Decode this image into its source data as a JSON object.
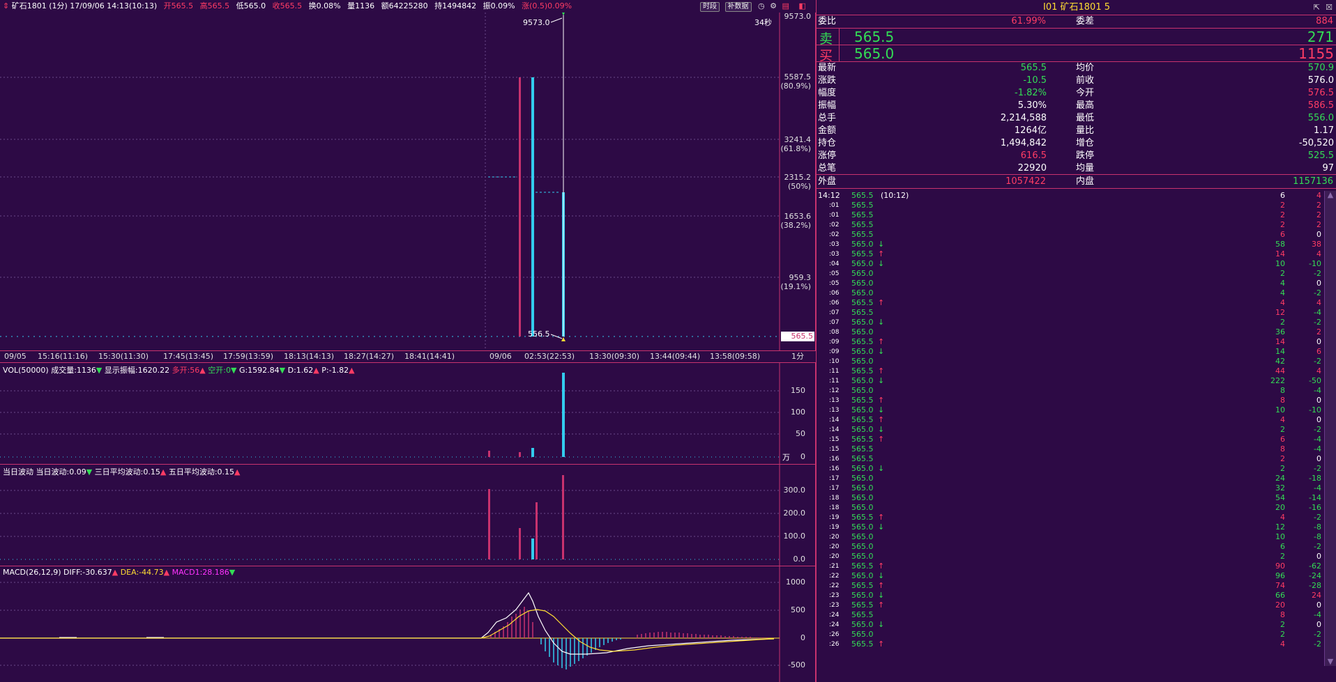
{
  "header": {
    "symbol": "矿石1801 (1分) 17/09/06 14:13(10:13)",
    "open": "开565.5",
    "high": "高565.5",
    "low": "低565.0",
    "close": "收565.5",
    "turnover": "换0.08%",
    "volume": "量1136",
    "amount": "额64225280",
    "position": "持1494842",
    "amplitude": "振0.09%",
    "change": "涨(0.5)0.09%",
    "btn_timeshare": "时段",
    "btn_supplement": "补数据"
  },
  "price_chart": {
    "countdown": "34秒",
    "peak_label": "9573.0",
    "low_label": "556.5",
    "current_price_tag": "565.5",
    "axis": [
      {
        "price": "9573.0",
        "pct": ""
      },
      {
        "price": "5587.5",
        "pct": "(80.9%)"
      },
      {
        "price": "3241.4",
        "pct": "(61.8%)"
      },
      {
        "price": "2315.2",
        "pct": "(50%)"
      },
      {
        "price": "1653.6",
        "pct": "(38.2%)"
      },
      {
        "price": "959.3",
        "pct": "(19.1%)"
      }
    ],
    "time_labels": [
      "09/05",
      "15:16(11:16)",
      "15:30(11:30)",
      "17:45(13:45)",
      "17:59(13:59)",
      "18:13(14:13)",
      "18:27(14:27)",
      "18:41(14:41)",
      "09/06",
      "02:53(22:53)",
      "13:30(09:30)",
      "13:44(09:44)",
      "13:58(09:58)"
    ],
    "period": "1分"
  },
  "vol_panel": {
    "title": "VOL(50000)",
    "volume": "成交量:1136",
    "display_amp": "显示振幅:1620.22",
    "long_open": "多开:56",
    "short_open": "空开:0",
    "g": "G:1592.84",
    "d": "D:1.62",
    "p": "P:-1.82",
    "axis": [
      "150",
      "100",
      "50",
      "0"
    ],
    "unit": "万"
  },
  "wave_panel": {
    "title": "当日波动",
    "today": "当日波动:0.09",
    "three_day": "三日平均波动:0.15",
    "five_day": "五日平均波动:0.15",
    "axis": [
      "300.0",
      "200.0",
      "100.0",
      "0.0"
    ]
  },
  "macd_panel": {
    "title": "MACD(26,12,9)",
    "diff": "DIFF:-30.637",
    "dea": "DEA:-44.73",
    "macd1": "MACD1:28.186",
    "axis": [
      "1000",
      "500",
      "0",
      "-500"
    ]
  },
  "quote": {
    "title": "I01 矿石1801 5",
    "ratio_label": "委比",
    "ratio_value": "61.99%",
    "diff_label": "委差",
    "diff_value": "884",
    "sell_label": "卖",
    "sell_price": "565.5",
    "sell_vol": "271",
    "buy_label": "买",
    "buy_price": "565.0",
    "buy_vol": "1155",
    "stats": [
      {
        "l": "最新",
        "v": "565.5",
        "vc": "green",
        "r": "均价",
        "rv": "570.9",
        "rc": "green"
      },
      {
        "l": "涨跌",
        "v": "-10.5",
        "vc": "green",
        "r": "前收",
        "rv": "576.0",
        "rc": "white"
      },
      {
        "l": "幅度",
        "v": "-1.82%",
        "vc": "green",
        "r": "今开",
        "rv": "576.5",
        "rc": "red"
      },
      {
        "l": "振幅",
        "v": "5.30%",
        "vc": "white",
        "r": "最高",
        "rv": "586.5",
        "rc": "red"
      },
      {
        "l": "总手",
        "v": "2,214,588",
        "vc": "white",
        "r": "最低",
        "rv": "556.0",
        "rc": "green"
      },
      {
        "l": "金额",
        "v": "1264亿",
        "vc": "white",
        "r": "量比",
        "rv": "1.17",
        "rc": "white"
      },
      {
        "l": "持仓",
        "v": "1,494,842",
        "vc": "white",
        "r": "增仓",
        "rv": "-50,520",
        "rc": "white"
      },
      {
        "l": "涨停",
        "v": "616.5",
        "vc": "red",
        "r": "跌停",
        "rv": "525.5",
        "rc": "green"
      },
      {
        "l": "总笔",
        "v": "22920",
        "vc": "white",
        "r": "均量",
        "rv": "97",
        "rc": "white"
      }
    ],
    "outer_label": "外盘",
    "outer_value": "1057422",
    "inner_label": "内盘",
    "inner_value": "1157136"
  },
  "ticks_header": {
    "time": "14:12",
    "price": "565.5",
    "note": "(10:12)",
    "vol": "6",
    "chg": "4"
  },
  "ticks": [
    {
      "t": ":01",
      "p": "565.5",
      "a": "",
      "v": "2",
      "c": "2",
      "vc": "red",
      "cc": "red"
    },
    {
      "t": ":01",
      "p": "565.5",
      "a": "",
      "v": "2",
      "c": "2",
      "vc": "red",
      "cc": "red"
    },
    {
      "t": ":02",
      "p": "565.5",
      "a": "",
      "v": "2",
      "c": "2",
      "vc": "red",
      "cc": "red"
    },
    {
      "t": ":02",
      "p": "565.5",
      "a": "",
      "v": "6",
      "c": "0",
      "vc": "red",
      "cc": "white"
    },
    {
      "t": ":03",
      "p": "565.0",
      "a": "↓",
      "v": "58",
      "c": "38",
      "vc": "green",
      "cc": "red"
    },
    {
      "t": ":03",
      "p": "565.5",
      "a": "↑",
      "v": "14",
      "c": "4",
      "vc": "red",
      "cc": "red"
    },
    {
      "t": ":04",
      "p": "565.0",
      "a": "↓",
      "v": "10",
      "c": "-10",
      "vc": "green",
      "cc": "green"
    },
    {
      "t": ":05",
      "p": "565.0",
      "a": "",
      "v": "2",
      "c": "-2",
      "vc": "green",
      "cc": "green"
    },
    {
      "t": ":05",
      "p": "565.0",
      "a": "",
      "v": "4",
      "c": "0",
      "vc": "green",
      "cc": "white"
    },
    {
      "t": ":06",
      "p": "565.0",
      "a": "",
      "v": "4",
      "c": "-2",
      "vc": "green",
      "cc": "green"
    },
    {
      "t": ":06",
      "p": "565.5",
      "a": "↑",
      "v": "4",
      "c": "4",
      "vc": "red",
      "cc": "red"
    },
    {
      "t": ":07",
      "p": "565.5",
      "a": "",
      "v": "12",
      "c": "-4",
      "vc": "red",
      "cc": "green"
    },
    {
      "t": ":07",
      "p": "565.0",
      "a": "↓",
      "v": "2",
      "c": "-2",
      "vc": "green",
      "cc": "green"
    },
    {
      "t": ":08",
      "p": "565.0",
      "a": "",
      "v": "36",
      "c": "2",
      "vc": "green",
      "cc": "red"
    },
    {
      "t": ":09",
      "p": "565.5",
      "a": "↑",
      "v": "14",
      "c": "0",
      "vc": "red",
      "cc": "white"
    },
    {
      "t": ":09",
      "p": "565.0",
      "a": "↓",
      "v": "14",
      "c": "6",
      "vc": "green",
      "cc": "red"
    },
    {
      "t": ":10",
      "p": "565.0",
      "a": "",
      "v": "42",
      "c": "-2",
      "vc": "green",
      "cc": "green"
    },
    {
      "t": ":11",
      "p": "565.5",
      "a": "↑",
      "v": "44",
      "c": "4",
      "vc": "red",
      "cc": "red"
    },
    {
      "t": ":11",
      "p": "565.0",
      "a": "↓",
      "v": "222",
      "c": "-50",
      "vc": "green",
      "cc": "green"
    },
    {
      "t": ":12",
      "p": "565.0",
      "a": "",
      "v": "8",
      "c": "-4",
      "vc": "green",
      "cc": "green"
    },
    {
      "t": ":13",
      "p": "565.5",
      "a": "↑",
      "v": "8",
      "c": "0",
      "vc": "red",
      "cc": "white"
    },
    {
      "t": ":13",
      "p": "565.0",
      "a": "↓",
      "v": "10",
      "c": "-10",
      "vc": "green",
      "cc": "green"
    },
    {
      "t": ":14",
      "p": "565.5",
      "a": "↑",
      "v": "4",
      "c": "0",
      "vc": "red",
      "cc": "white"
    },
    {
      "t": ":14",
      "p": "565.0",
      "a": "↓",
      "v": "2",
      "c": "-2",
      "vc": "green",
      "cc": "green"
    },
    {
      "t": ":15",
      "p": "565.5",
      "a": "↑",
      "v": "6",
      "c": "-4",
      "vc": "red",
      "cc": "green"
    },
    {
      "t": ":15",
      "p": "565.5",
      "a": "",
      "v": "8",
      "c": "-4",
      "vc": "red",
      "cc": "green"
    },
    {
      "t": ":16",
      "p": "565.5",
      "a": "",
      "v": "2",
      "c": "0",
      "vc": "red",
      "cc": "white"
    },
    {
      "t": ":16",
      "p": "565.0",
      "a": "↓",
      "v": "2",
      "c": "-2",
      "vc": "green",
      "cc": "green"
    },
    {
      "t": ":17",
      "p": "565.0",
      "a": "",
      "v": "24",
      "c": "-18",
      "vc": "green",
      "cc": "green"
    },
    {
      "t": ":17",
      "p": "565.0",
      "a": "",
      "v": "32",
      "c": "-4",
      "vc": "green",
      "cc": "green"
    },
    {
      "t": ":18",
      "p": "565.0",
      "a": "",
      "v": "54",
      "c": "-14",
      "vc": "green",
      "cc": "green"
    },
    {
      "t": ":18",
      "p": "565.0",
      "a": "",
      "v": "20",
      "c": "-16",
      "vc": "green",
      "cc": "green"
    },
    {
      "t": ":19",
      "p": "565.5",
      "a": "↑",
      "v": "4",
      "c": "-2",
      "vc": "red",
      "cc": "green"
    },
    {
      "t": ":19",
      "p": "565.0",
      "a": "↓",
      "v": "12",
      "c": "-8",
      "vc": "green",
      "cc": "green"
    },
    {
      "t": ":20",
      "p": "565.0",
      "a": "",
      "v": "10",
      "c": "-8",
      "vc": "green",
      "cc": "green"
    },
    {
      "t": ":20",
      "p": "565.0",
      "a": "",
      "v": "6",
      "c": "-2",
      "vc": "green",
      "cc": "green"
    },
    {
      "t": ":20",
      "p": "565.0",
      "a": "",
      "v": "2",
      "c": "0",
      "vc": "green",
      "cc": "white"
    },
    {
      "t": ":21",
      "p": "565.5",
      "a": "↑",
      "v": "90",
      "c": "-62",
      "vc": "red",
      "cc": "green"
    },
    {
      "t": ":22",
      "p": "565.0",
      "a": "↓",
      "v": "96",
      "c": "-24",
      "vc": "green",
      "cc": "green"
    },
    {
      "t": ":22",
      "p": "565.5",
      "a": "↑",
      "v": "74",
      "c": "-28",
      "vc": "red",
      "cc": "green"
    },
    {
      "t": ":23",
      "p": "565.0",
      "a": "↓",
      "v": "66",
      "c": "24",
      "vc": "green",
      "cc": "red"
    },
    {
      "t": ":23",
      "p": "565.5",
      "a": "↑",
      "v": "20",
      "c": "0",
      "vc": "red",
      "cc": "white"
    },
    {
      "t": ":24",
      "p": "565.5",
      "a": "",
      "v": "8",
      "c": "-4",
      "vc": "red",
      "cc": "green"
    },
    {
      "t": ":24",
      "p": "565.0",
      "a": "↓",
      "v": "2",
      "c": "0",
      "vc": "green",
      "cc": "white"
    },
    {
      "t": ":26",
      "p": "565.0",
      "a": "",
      "v": "2",
      "c": "-2",
      "vc": "green",
      "cc": "green"
    },
    {
      "t": ":26",
      "p": "565.5",
      "a": "↑",
      "v": "4",
      "c": "-2",
      "vc": "red",
      "cc": "green"
    }
  ],
  "colors": {
    "bg": "#2d0a45",
    "up": "#ff3c64",
    "down": "#33dd55",
    "cyan": "#33ccee",
    "yellow": "#ffdd33",
    "accent": "#c8326e"
  }
}
